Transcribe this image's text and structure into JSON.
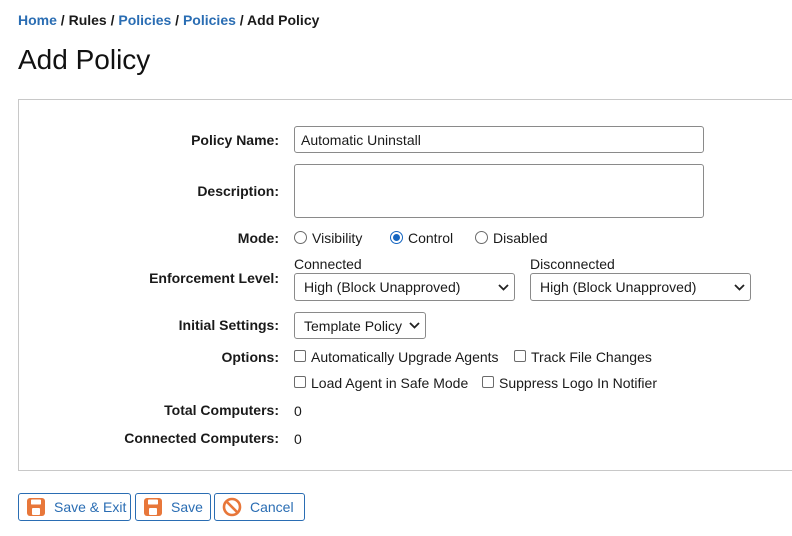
{
  "breadcrumb": {
    "home": "Home",
    "sep": " / ",
    "rules": "Rules",
    "policies1": "Policies",
    "policies2": "Policies",
    "current": "Add Policy"
  },
  "page": {
    "title": "Add Policy"
  },
  "form": {
    "policy_name": {
      "label": "Policy Name:",
      "value": "Automatic Uninstall"
    },
    "description": {
      "label": "Description:",
      "value": ""
    },
    "mode": {
      "label": "Mode:",
      "options": [
        "Visibility",
        "Control",
        "Disabled"
      ],
      "selected": "Control"
    },
    "enforcement": {
      "label": "Enforcement Level:",
      "connected": {
        "heading": "Connected",
        "value": "High (Block Unapproved)"
      },
      "disconnected": {
        "heading": "Disconnected",
        "value": "High (Block Unapproved)"
      }
    },
    "initial_settings": {
      "label": "Initial Settings:",
      "value": "Template Policy"
    },
    "options": {
      "label": "Options:",
      "items": [
        {
          "label": "Automatically Upgrade Agents",
          "checked": false
        },
        {
          "label": "Track File Changes",
          "checked": false
        },
        {
          "label": "Load Agent in Safe Mode",
          "checked": false
        },
        {
          "label": "Suppress Logo In Notifier",
          "checked": false
        }
      ]
    },
    "total_computers": {
      "label": "Total Computers:",
      "value": "0"
    },
    "connected_computers": {
      "label": "Connected Computers:",
      "value": "0"
    }
  },
  "buttons": {
    "save_exit": "Save & Exit",
    "save": "Save",
    "cancel": "Cancel"
  },
  "colors": {
    "link": "#2a6db3",
    "icon_orange": "#e8773a",
    "radio_selected": "#1565c0"
  }
}
